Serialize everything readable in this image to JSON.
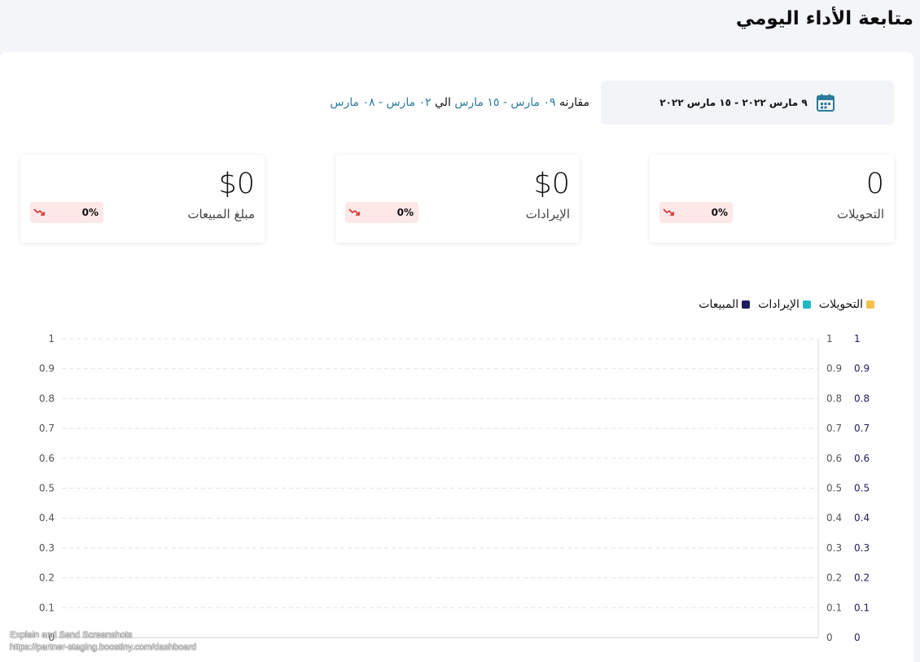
{
  "header": {
    "title": "متابعة الأداء اليومي"
  },
  "date_picker": {
    "range": "٩ مارس ٢٠٢٢ - ١٥ مارس ٢٠٢٢",
    "icon": "calendar-icon"
  },
  "comparison": {
    "prefix": "مقارنه",
    "current_range": "٠٩ مارس - ١٥ مارس",
    "joiner": "الي",
    "previous_range": "٠٢ مارس - ٠٨ مارس"
  },
  "stats": [
    {
      "label": "التحويلات",
      "value": "0",
      "change": "0%"
    },
    {
      "label": "الإيرادات",
      "value": "$0",
      "change": "0%"
    },
    {
      "label": "مبلغ المبيعات",
      "value": "$0",
      "change": "0%"
    }
  ],
  "legend": [
    {
      "label": "التحويلات",
      "color": "#f2c14e"
    },
    {
      "label": "الإيرادات",
      "color": "#22b8c8"
    },
    {
      "label": "المبيعات",
      "color": "#1f1d5c"
    }
  ],
  "colors": {
    "accent": "#2b7b9a",
    "negative": "#d92c2c",
    "badge_bg": "#fde7e7"
  },
  "chart_data": {
    "type": "line",
    "series": [
      {
        "name": "التحويلات",
        "values": []
      },
      {
        "name": "الإيرادات",
        "values": []
      },
      {
        "name": "المبيعات",
        "values": []
      }
    ],
    "y_ticks": [
      "0",
      "0.1",
      "0.2",
      "0.3",
      "0.4",
      "0.5",
      "0.6",
      "0.7",
      "0.8",
      "0.9",
      "1"
    ],
    "ylim": [
      0,
      1
    ],
    "grid": true,
    "legend_placement": "top-right"
  },
  "overlay": {
    "line1": "Explain and Send Screenshots",
    "line2": "https://partner-staging.boostiny.com/dashboard"
  }
}
